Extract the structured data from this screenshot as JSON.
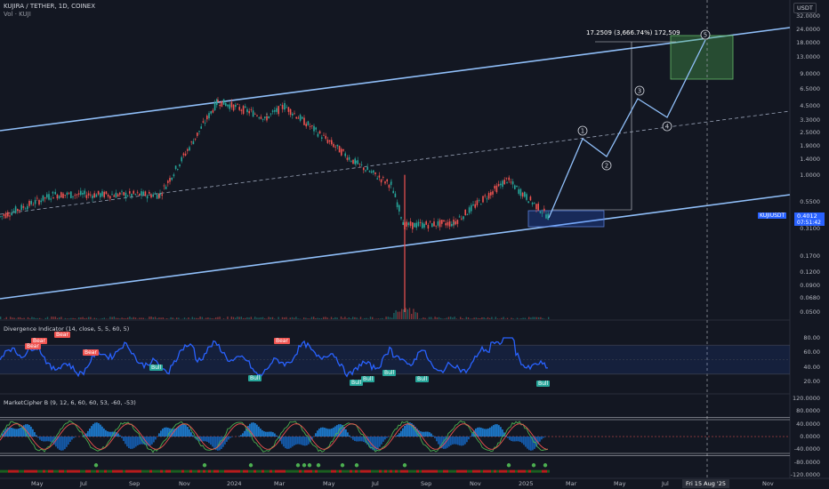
{
  "header": {
    "title": "KUJIRA / TETHER, 1D, COINEX",
    "volume": "Vol · KUJI",
    "currency": "USDT"
  },
  "price_axis": [
    "32.0000",
    "24.0000",
    "18.0000",
    "13.0000",
    "9.0000",
    "6.5000",
    "4.5000",
    "3.3000",
    "2.5000",
    "1.9000",
    "1.4000",
    "1.0000",
    "0.5500",
    "0.3100",
    "0.1700",
    "0.1200",
    "0.0900",
    "0.0680",
    "0.0500"
  ],
  "indicator_axis": [
    "80.00",
    "60.00",
    "40.00",
    "20.00"
  ],
  "mc_axis": [
    "120.0000",
    "80.0000",
    "40.0000",
    "0.0000",
    "-40.0000",
    "-80.0000",
    "-120.0000"
  ],
  "time_axis": [
    "May",
    "Jul",
    "Sep",
    "Nov",
    "2024",
    "Mar",
    "May",
    "Jul",
    "Sep",
    "Nov",
    "2025",
    "Mar",
    "May",
    "Jul",
    "Nov"
  ],
  "crosshair_date": "Fri 15 Aug '25",
  "price_tag": {
    "symbol": "KUJIUSDT",
    "value": "0.4012",
    "countdown": "07:51:42"
  },
  "target_label": "17.2509 (3,666.74%) 172,509",
  "waves": [
    "1",
    "2",
    "3",
    "4",
    "5"
  ],
  "divergence": {
    "title": "Divergence Indicator (14, close, 5, 5, 60, 5)",
    "bear": "Bear",
    "bull": "Bull"
  },
  "market_cipher": {
    "title": "MarketCipher B (9, 12, 6, 60, 60, 53, -60, -53)"
  },
  "colors": {
    "background": "#131722",
    "channel": "#90bff9",
    "up": "#26a69a",
    "down": "#ef5350",
    "osc": "#2962ff",
    "target_box": "#4caf50",
    "entry_box": "#2962ff"
  },
  "chart_data": {
    "type": "line",
    "title": "KUJIRA / TETHER, 1D, COINEX",
    "xlabel": "",
    "ylabel": "",
    "y_scale": "log",
    "x": [
      "May",
      "Jul",
      "Sep",
      "Nov",
      "2024",
      "Mar",
      "May",
      "Jul",
      "Sep",
      "Nov",
      "2025"
    ],
    "series": [
      {
        "name": "",
        "values": [
          0.4,
          0.65,
          0.65,
          5.0,
          3.5,
          4.5,
          1.3,
          0.8,
          0.33,
          0.35,
          0.9,
          0.4012
        ]
      }
    ],
    "ylim": [
      0.05,
      32.0
    ]
  }
}
